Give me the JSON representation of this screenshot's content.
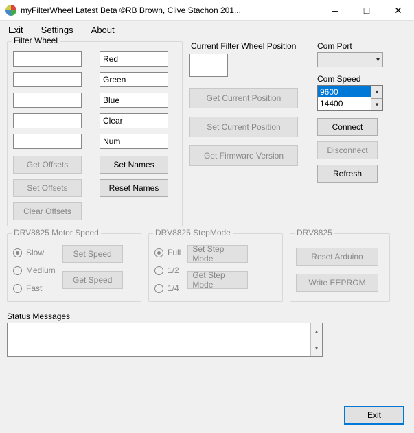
{
  "window": {
    "title": "myFilterWheel Latest Beta ©RB Brown, Clive Stachon 201..."
  },
  "menu": {
    "exit": "Exit",
    "settings": "Settings",
    "about": "About"
  },
  "filterWheel": {
    "label": "Filter Wheel",
    "offsets": [
      "",
      "",
      "",
      "",
      ""
    ],
    "names": [
      "Red",
      "Green",
      "Blue",
      "Clear",
      "Num"
    ],
    "btnGetOffsets": "Get Offsets",
    "btnSetOffsets": "Set Offsets",
    "btnClearOffsets": "Clear Offsets",
    "btnSetNames": "Set Names",
    "btnResetNames": "Reset Names"
  },
  "position": {
    "label": "Current Filter Wheel Position",
    "value": "",
    "btnGet": "Get Current Position",
    "btnSet": "Set Current Position",
    "btnFw": "Get Firmware Version"
  },
  "com": {
    "portLabel": "Com Port",
    "portValue": "",
    "speedLabel": "Com Speed",
    "speedOptions": [
      "9600",
      "14400"
    ],
    "speedSelected": "9600",
    "btnConnect": "Connect",
    "btnDisconnect": "Disconnect",
    "btnRefresh": "Refresh"
  },
  "motorSpeed": {
    "label": "DRV8825 Motor Speed",
    "optSlow": "Slow",
    "optMedium": "Medium",
    "optFast": "Fast",
    "btnSet": "Set Speed",
    "btnGet": "Get Speed"
  },
  "stepMode": {
    "label": "DRV8825 StepMode",
    "optFull": "Full",
    "optHalf": "1/2",
    "optQuarter": "1/4",
    "btnSet": "Set Step Mode",
    "btnGet": "Get Step Mode"
  },
  "drv": {
    "label": "DRV8825",
    "btnReset": "Reset Arduino",
    "btnEeprom": "Write EEPROM"
  },
  "status": {
    "label": "Status Messages",
    "value": ""
  },
  "exit": "Exit"
}
